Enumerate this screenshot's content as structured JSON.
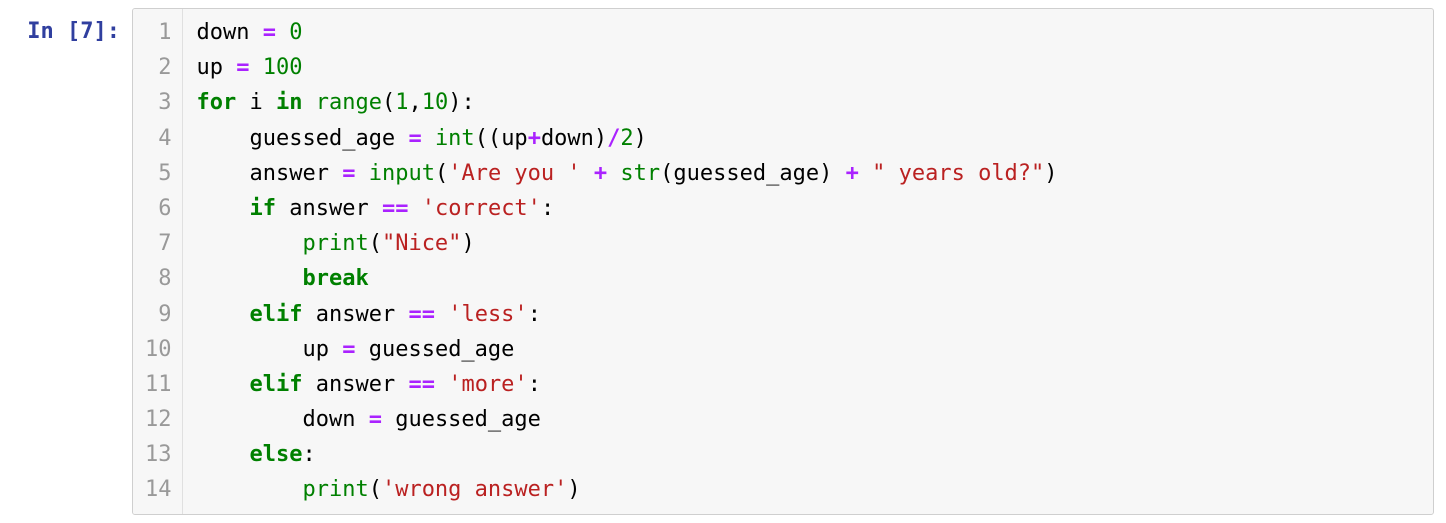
{
  "prompt": {
    "in": "In ",
    "open": "[",
    "num": "7",
    "close": "]:",
    "full": "In [7]:"
  },
  "code": {
    "lineNumbers": [
      "1",
      "2",
      "3",
      "4",
      "5",
      "6",
      "7",
      "8",
      "9",
      "10",
      "11",
      "12",
      "13",
      "14"
    ],
    "lines": [
      [
        {
          "cls": "tok-name",
          "t": "down"
        },
        {
          "cls": "tok-par",
          "t": " "
        },
        {
          "cls": "tok-op",
          "t": "="
        },
        {
          "cls": "tok-par",
          "t": " "
        },
        {
          "cls": "tok-num",
          "t": "0"
        }
      ],
      [
        {
          "cls": "tok-name",
          "t": "up"
        },
        {
          "cls": "tok-par",
          "t": " "
        },
        {
          "cls": "tok-op",
          "t": "="
        },
        {
          "cls": "tok-par",
          "t": " "
        },
        {
          "cls": "tok-num",
          "t": "100"
        }
      ],
      [
        {
          "cls": "tok-kw",
          "t": "for"
        },
        {
          "cls": "tok-par",
          "t": " "
        },
        {
          "cls": "tok-name",
          "t": "i"
        },
        {
          "cls": "tok-par",
          "t": " "
        },
        {
          "cls": "tok-kw",
          "t": "in"
        },
        {
          "cls": "tok-par",
          "t": " "
        },
        {
          "cls": "tok-bi",
          "t": "range"
        },
        {
          "cls": "tok-par",
          "t": "("
        },
        {
          "cls": "tok-num",
          "t": "1"
        },
        {
          "cls": "tok-par",
          "t": ","
        },
        {
          "cls": "tok-num",
          "t": "10"
        },
        {
          "cls": "tok-par",
          "t": "):"
        }
      ],
      [
        {
          "cls": "tok-par",
          "t": "    "
        },
        {
          "cls": "tok-name",
          "t": "guessed_age"
        },
        {
          "cls": "tok-par",
          "t": " "
        },
        {
          "cls": "tok-op",
          "t": "="
        },
        {
          "cls": "tok-par",
          "t": " "
        },
        {
          "cls": "tok-bi",
          "t": "int"
        },
        {
          "cls": "tok-par",
          "t": "(("
        },
        {
          "cls": "tok-name",
          "t": "up"
        },
        {
          "cls": "tok-op",
          "t": "+"
        },
        {
          "cls": "tok-name",
          "t": "down"
        },
        {
          "cls": "tok-par",
          "t": ")"
        },
        {
          "cls": "tok-op",
          "t": "/"
        },
        {
          "cls": "tok-num",
          "t": "2"
        },
        {
          "cls": "tok-par",
          "t": ")"
        }
      ],
      [
        {
          "cls": "tok-par",
          "t": "    "
        },
        {
          "cls": "tok-name",
          "t": "answer"
        },
        {
          "cls": "tok-par",
          "t": " "
        },
        {
          "cls": "tok-op",
          "t": "="
        },
        {
          "cls": "tok-par",
          "t": " "
        },
        {
          "cls": "tok-bi",
          "t": "input"
        },
        {
          "cls": "tok-par",
          "t": "("
        },
        {
          "cls": "tok-str",
          "t": "'Are you '"
        },
        {
          "cls": "tok-par",
          "t": " "
        },
        {
          "cls": "tok-op",
          "t": "+"
        },
        {
          "cls": "tok-par",
          "t": " "
        },
        {
          "cls": "tok-bi",
          "t": "str"
        },
        {
          "cls": "tok-par",
          "t": "("
        },
        {
          "cls": "tok-name",
          "t": "guessed_age"
        },
        {
          "cls": "tok-par",
          "t": ")"
        },
        {
          "cls": "tok-par",
          "t": " "
        },
        {
          "cls": "tok-op",
          "t": "+"
        },
        {
          "cls": "tok-par",
          "t": " "
        },
        {
          "cls": "tok-str",
          "t": "\" years old?\""
        },
        {
          "cls": "tok-par",
          "t": ")"
        }
      ],
      [
        {
          "cls": "tok-par",
          "t": "    "
        },
        {
          "cls": "tok-kw",
          "t": "if"
        },
        {
          "cls": "tok-par",
          "t": " "
        },
        {
          "cls": "tok-name",
          "t": "answer"
        },
        {
          "cls": "tok-par",
          "t": " "
        },
        {
          "cls": "tok-op",
          "t": "=="
        },
        {
          "cls": "tok-par",
          "t": " "
        },
        {
          "cls": "tok-str",
          "t": "'correct'"
        },
        {
          "cls": "tok-par",
          "t": ":"
        }
      ],
      [
        {
          "cls": "tok-par",
          "t": "        "
        },
        {
          "cls": "tok-bi",
          "t": "print"
        },
        {
          "cls": "tok-par",
          "t": "("
        },
        {
          "cls": "tok-str",
          "t": "\"Nice\""
        },
        {
          "cls": "tok-par",
          "t": ")"
        }
      ],
      [
        {
          "cls": "tok-par",
          "t": "        "
        },
        {
          "cls": "tok-kw",
          "t": "break"
        }
      ],
      [
        {
          "cls": "tok-par",
          "t": "    "
        },
        {
          "cls": "tok-kw",
          "t": "elif"
        },
        {
          "cls": "tok-par",
          "t": " "
        },
        {
          "cls": "tok-name",
          "t": "answer"
        },
        {
          "cls": "tok-par",
          "t": " "
        },
        {
          "cls": "tok-op",
          "t": "=="
        },
        {
          "cls": "tok-par",
          "t": " "
        },
        {
          "cls": "tok-str",
          "t": "'less'"
        },
        {
          "cls": "tok-par",
          "t": ":"
        }
      ],
      [
        {
          "cls": "tok-par",
          "t": "        "
        },
        {
          "cls": "tok-name",
          "t": "up"
        },
        {
          "cls": "tok-par",
          "t": " "
        },
        {
          "cls": "tok-op",
          "t": "="
        },
        {
          "cls": "tok-par",
          "t": " "
        },
        {
          "cls": "tok-name",
          "t": "guessed_age"
        }
      ],
      [
        {
          "cls": "tok-par",
          "t": "    "
        },
        {
          "cls": "tok-kw",
          "t": "elif"
        },
        {
          "cls": "tok-par",
          "t": " "
        },
        {
          "cls": "tok-name",
          "t": "answer"
        },
        {
          "cls": "tok-par",
          "t": " "
        },
        {
          "cls": "tok-op",
          "t": "=="
        },
        {
          "cls": "tok-par",
          "t": " "
        },
        {
          "cls": "tok-str",
          "t": "'more'"
        },
        {
          "cls": "tok-par",
          "t": ":"
        }
      ],
      [
        {
          "cls": "tok-par",
          "t": "        "
        },
        {
          "cls": "tok-name",
          "t": "down"
        },
        {
          "cls": "tok-par",
          "t": " "
        },
        {
          "cls": "tok-op",
          "t": "="
        },
        {
          "cls": "tok-par",
          "t": " "
        },
        {
          "cls": "tok-name",
          "t": "guessed_age"
        }
      ],
      [
        {
          "cls": "tok-par",
          "t": "    "
        },
        {
          "cls": "tok-kw",
          "t": "else"
        },
        {
          "cls": "tok-par",
          "t": ":"
        }
      ],
      [
        {
          "cls": "tok-par",
          "t": "        "
        },
        {
          "cls": "tok-bi",
          "t": "print"
        },
        {
          "cls": "tok-par",
          "t": "("
        },
        {
          "cls": "tok-str",
          "t": "'wrong answer'"
        },
        {
          "cls": "tok-par",
          "t": ")"
        }
      ]
    ]
  }
}
